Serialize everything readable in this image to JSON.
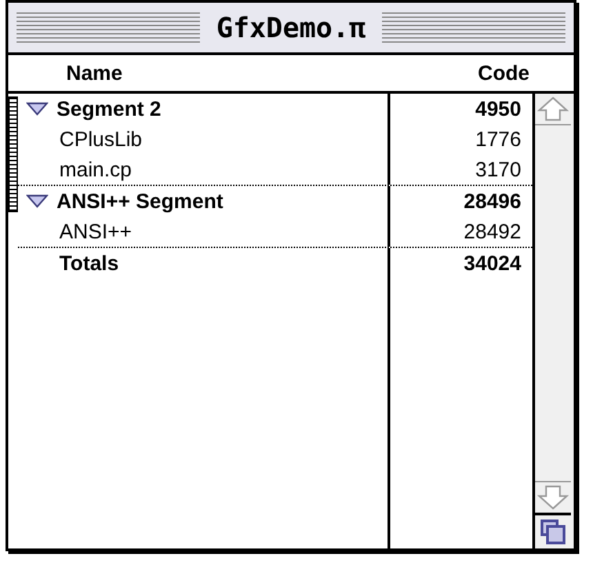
{
  "window": {
    "title": "GfxDemo.π"
  },
  "columns": [
    "Name",
    "Code"
  ],
  "segments": [
    {
      "name": "Segment 2",
      "code": "4950",
      "expanded": true,
      "children": [
        {
          "name": "CPlusLib",
          "code": "1776"
        },
        {
          "name": "main.cp",
          "code": "3170"
        }
      ]
    },
    {
      "name": "ANSI++ Segment",
      "code": "28496",
      "expanded": true,
      "children": [
        {
          "name": "ANSI++",
          "code": "28492"
        }
      ]
    }
  ],
  "totals": {
    "name": "Totals",
    "code": "34024"
  }
}
